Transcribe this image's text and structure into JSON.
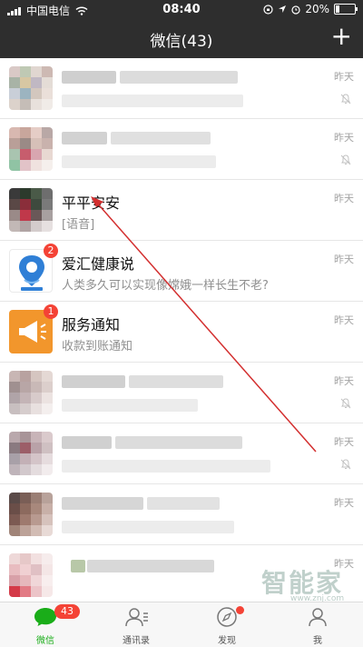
{
  "status_bar": {
    "carrier": "中国电信",
    "time": "08:40",
    "battery": "20%",
    "battery_level": 0.2
  },
  "nav": {
    "title": "微信(43)",
    "add_icon": "plus-icon"
  },
  "chats": [
    {
      "name": "",
      "preview": "",
      "time": "昨天",
      "muted": true
    },
    {
      "name": "",
      "preview": "",
      "time": "昨天",
      "muted": true
    },
    {
      "name": "平平安安",
      "preview": "[语音]",
      "time": "昨天",
      "muted": false
    },
    {
      "name": "爱汇健康说",
      "preview": "人类多久可以实现像嫦娥一样长生不老?",
      "time": "昨天",
      "muted": false,
      "badge": "2"
    },
    {
      "name": "服务通知",
      "preview": "收款到账通知",
      "time": "昨天",
      "muted": false,
      "badge": "1"
    },
    {
      "name": "",
      "preview": "",
      "time": "昨天",
      "muted": true
    },
    {
      "name": "",
      "preview": "",
      "time": "昨天",
      "muted": true
    },
    {
      "name": "",
      "preview": "",
      "time": "昨天",
      "muted": false
    },
    {
      "name": "",
      "preview": "",
      "time": "昨天",
      "muted": false
    }
  ],
  "tabs": [
    {
      "label": "微信",
      "icon": "chat-icon",
      "badge": "43",
      "active": true
    },
    {
      "label": "通讯录",
      "icon": "contacts-icon",
      "active": false
    },
    {
      "label": "发现",
      "icon": "compass-icon",
      "active": false
    },
    {
      "label": "我",
      "icon": "person-icon",
      "active": false
    }
  ],
  "watermark": {
    "brand": "智能家",
    "site": "www.znj.com"
  },
  "colors": {
    "header": "#2e2e2e",
    "accent": "#1aad19",
    "badge": "#f44336",
    "annotation_arrow": "#d32f2f"
  }
}
